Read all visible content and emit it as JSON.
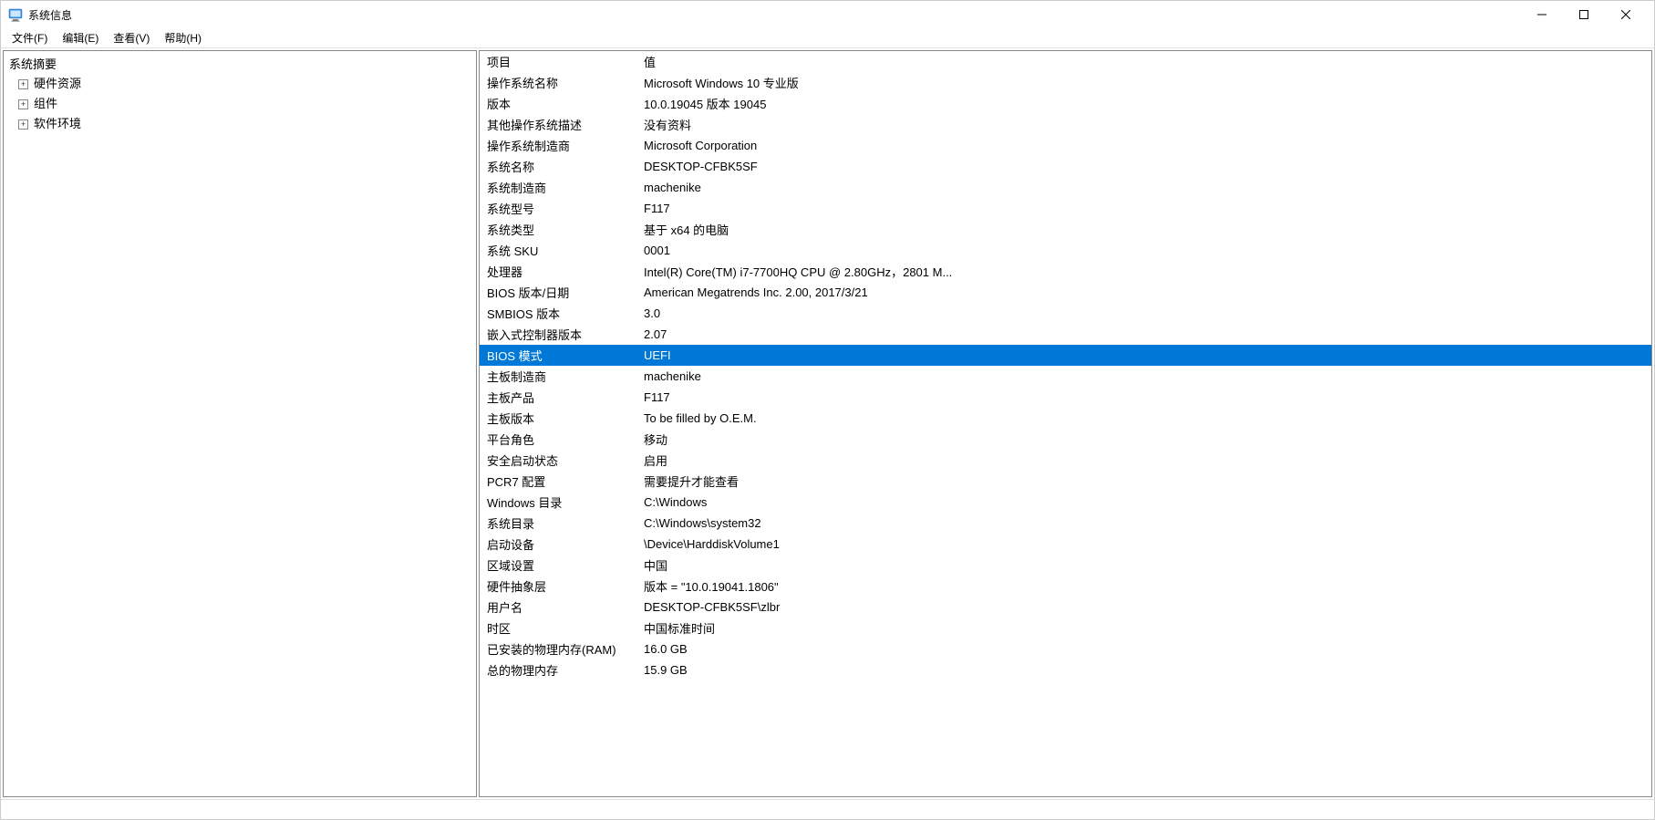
{
  "window": {
    "title": "系统信息"
  },
  "menubar": {
    "file": "文件(F)",
    "edit": "编辑(E)",
    "view": "查看(V)",
    "help": "帮助(H)"
  },
  "tree": {
    "root": "系统摘要",
    "nodes": [
      {
        "label": "硬件资源"
      },
      {
        "label": "组件"
      },
      {
        "label": "软件环境"
      }
    ]
  },
  "details": {
    "header_item": "项目",
    "header_value": "值",
    "selected_index": 13,
    "rows": [
      {
        "item": "操作系统名称",
        "value": "Microsoft Windows 10 专业版"
      },
      {
        "item": "版本",
        "value": "10.0.19045 版本 19045"
      },
      {
        "item": "其他操作系统描述",
        "value": "没有资料"
      },
      {
        "item": "操作系统制造商",
        "value": "Microsoft Corporation"
      },
      {
        "item": "系统名称",
        "value": "DESKTOP-CFBK5SF"
      },
      {
        "item": "系统制造商",
        "value": "machenike"
      },
      {
        "item": "系统型号",
        "value": "F117"
      },
      {
        "item": "系统类型",
        "value": "基于 x64 的电脑"
      },
      {
        "item": "系统 SKU",
        "value": "0001"
      },
      {
        "item": "处理器",
        "value": "Intel(R) Core(TM) i7-7700HQ CPU @ 2.80GHz，2801 M..."
      },
      {
        "item": "BIOS 版本/日期",
        "value": "American Megatrends Inc. 2.00, 2017/3/21"
      },
      {
        "item": "SMBIOS 版本",
        "value": "3.0"
      },
      {
        "item": "嵌入式控制器版本",
        "value": "2.07"
      },
      {
        "item": "BIOS 模式",
        "value": "UEFI"
      },
      {
        "item": "主板制造商",
        "value": "machenike"
      },
      {
        "item": "主板产品",
        "value": "F117"
      },
      {
        "item": "主板版本",
        "value": "To be filled by O.E.M."
      },
      {
        "item": "平台角色",
        "value": "移动"
      },
      {
        "item": "安全启动状态",
        "value": "启用"
      },
      {
        "item": "PCR7 配置",
        "value": "需要提升才能查看"
      },
      {
        "item": "Windows 目录",
        "value": "C:\\Windows"
      },
      {
        "item": "系统目录",
        "value": "C:\\Windows\\system32"
      },
      {
        "item": "启动设备",
        "value": "\\Device\\HarddiskVolume1"
      },
      {
        "item": "区域设置",
        "value": "中国"
      },
      {
        "item": "硬件抽象层",
        "value": "版本 = \"10.0.19041.1806\""
      },
      {
        "item": "用户名",
        "value": "DESKTOP-CFBK5SF\\zlbr"
      },
      {
        "item": "时区",
        "value": "中国标准时间"
      },
      {
        "item": "已安装的物理内存(RAM)",
        "value": "16.0 GB"
      },
      {
        "item": "总的物理内存",
        "value": "15.9 GB"
      }
    ]
  }
}
